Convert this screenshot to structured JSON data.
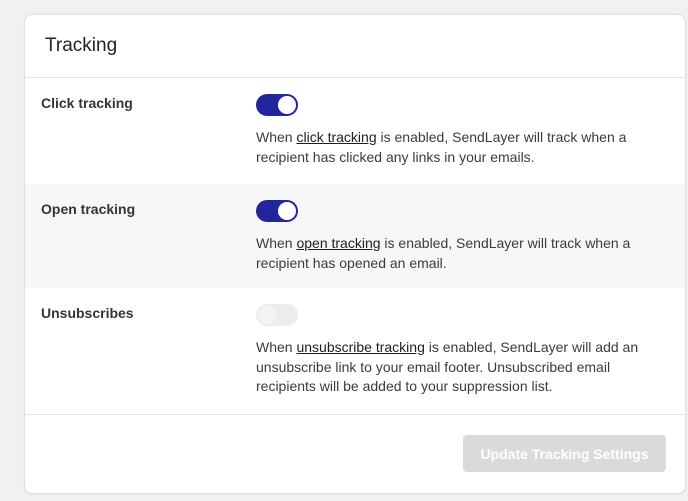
{
  "card": {
    "title": "Tracking"
  },
  "settings": [
    {
      "label": "Click tracking",
      "enabled": true,
      "desc_before": "When ",
      "link_text": "click tracking",
      "desc_after": " is enabled, SendLayer will track when a recipient has clicked any links in your emails."
    },
    {
      "label": "Open tracking",
      "enabled": true,
      "desc_before": "When ",
      "link_text": "open tracking",
      "desc_after": " is enabled, SendLayer will track when a recipient has opened an email."
    },
    {
      "label": "Unsubscribes",
      "enabled": false,
      "desc_before": "When ",
      "link_text": "unsubscribe tracking",
      "desc_after": " is enabled, SendLayer will add an unsubscribe link to your email footer. Unsubscribed email recipients will be added to your suppression list."
    }
  ],
  "footer": {
    "button_label": "Update Tracking Settings",
    "button_disabled": true
  },
  "colors": {
    "toggle_on": "#23259e",
    "toggle_off": "#ececef",
    "button_disabled": "#dadadd"
  }
}
